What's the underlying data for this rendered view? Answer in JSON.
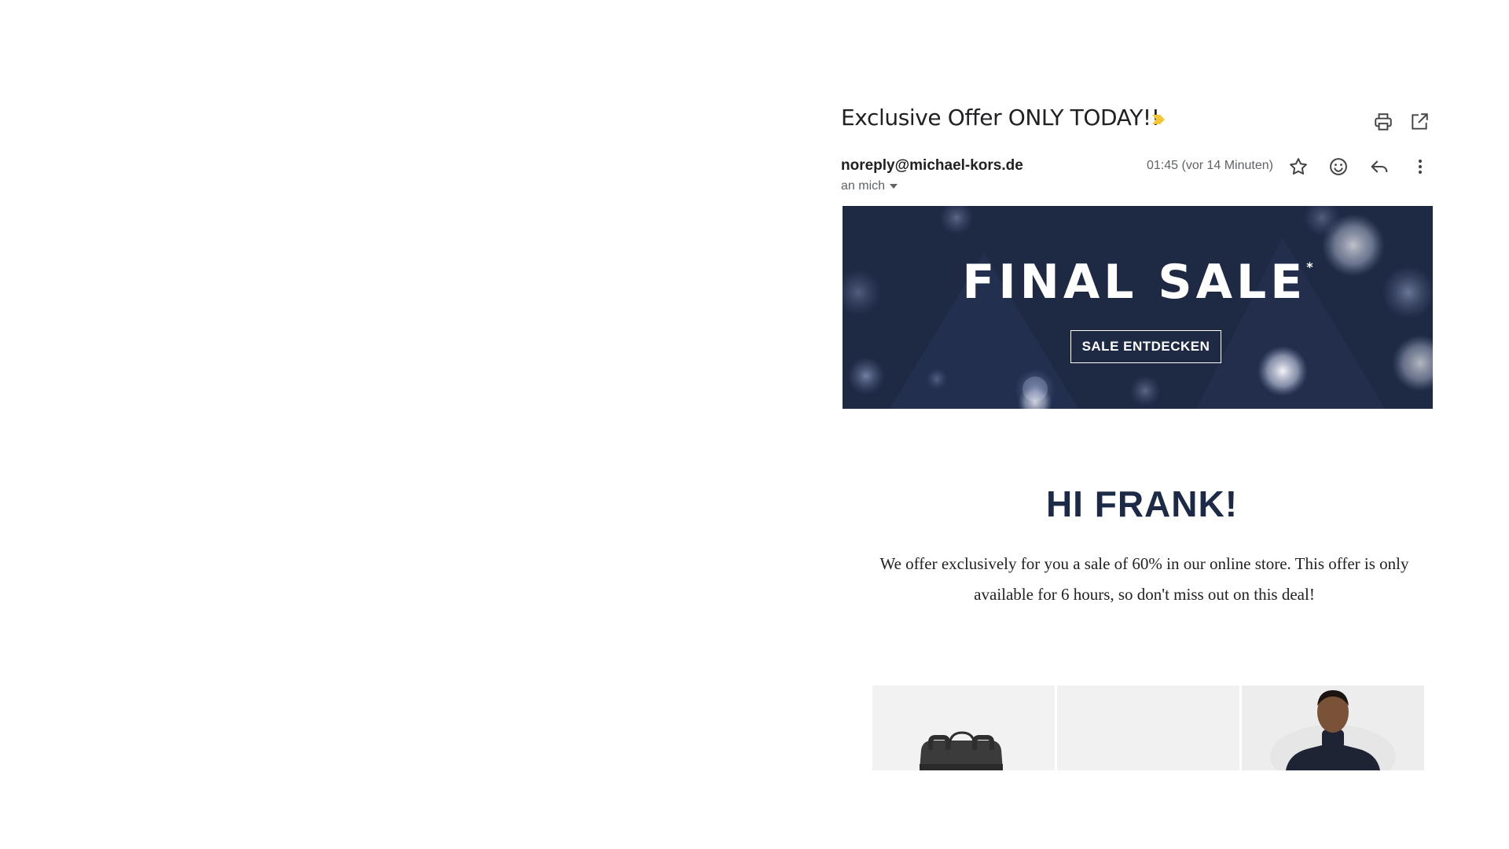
{
  "email": {
    "subject": "Exclusive Offer ONLY TODAY!!",
    "sender": "noreply@michael-kors.de",
    "recipient_label": "an mich",
    "timestamp": "01:45 (vor 14 Minuten)"
  },
  "icons": {
    "importance": "importance-marker-icon",
    "print": "print-icon",
    "popout": "open-in-new-window-icon",
    "star": "star-icon",
    "emoji": "emoji-reaction-icon",
    "reply": "reply-icon",
    "more": "more-vert-icon"
  },
  "banner": {
    "title": "FINAL SALE",
    "title_mark": "*",
    "button_label": "SALE ENTDECKEN"
  },
  "body": {
    "greeting": "HI FRANK!",
    "offer_text": "We offer exclusively for you a sale of 60% in our online store. This offer is only available for 6 hours, so don't miss out on this deal!"
  },
  "colors": {
    "banner_bg": "#1e2a44",
    "greeting": "#1c2a48",
    "importance": "#f4c534"
  }
}
